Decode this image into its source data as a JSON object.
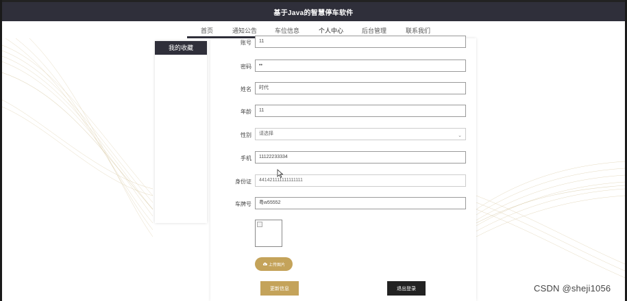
{
  "app": {
    "title": "基于Java的智慧停车软件"
  },
  "nav": {
    "items": [
      {
        "label": "首页"
      },
      {
        "label": "通知公告"
      },
      {
        "label": "车位信息"
      },
      {
        "label": "个人中心"
      },
      {
        "label": "后台管理"
      },
      {
        "label": "联系我们"
      }
    ],
    "active_index": 3
  },
  "sidebar": {
    "title": "我的收藏"
  },
  "form": {
    "fields": [
      {
        "label": "账号",
        "value": "11"
      },
      {
        "label": "密码",
        "value": "••"
      },
      {
        "label": "姓名",
        "value": "时代"
      },
      {
        "label": "年龄",
        "value": "11"
      },
      {
        "label": "性别",
        "value": "请选择"
      },
      {
        "label": "手机",
        "value": "11122233334"
      },
      {
        "label": "身份证",
        "value": "441421111111111111"
      },
      {
        "label": "车牌号",
        "value": "粤w55552"
      }
    ],
    "upload_label": "上传图片",
    "update_label": "更新信息",
    "logout_label": "退出登录"
  },
  "icons": {
    "upload": "cloud-upload-icon",
    "select_arrow": "chevron-down-icon",
    "cursor": "mouse-pointer-icon"
  },
  "colors": {
    "accent": "#c4a35a",
    "dark": "#2f2f3a"
  },
  "watermark": "CSDN @sheji1056"
}
